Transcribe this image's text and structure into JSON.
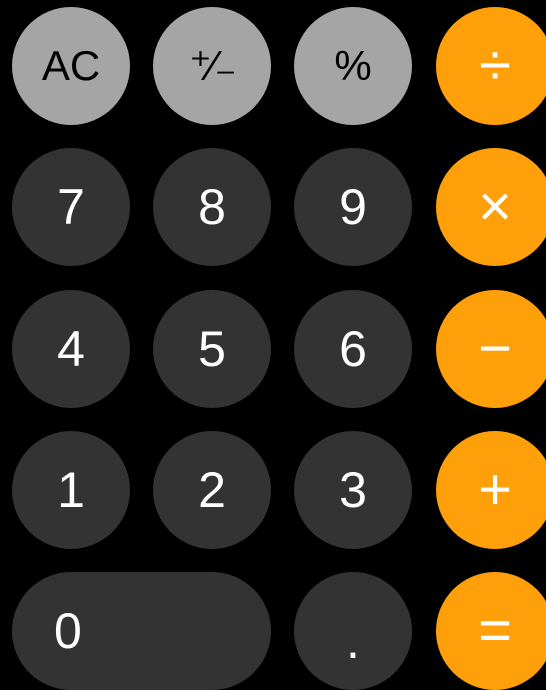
{
  "keypad": {
    "row1": {
      "ac": "AC",
      "plus_minus": "⁺∕₋",
      "percent": "%",
      "divide": "÷"
    },
    "row2": {
      "seven": "7",
      "eight": "8",
      "nine": "9",
      "multiply": "×"
    },
    "row3": {
      "four": "4",
      "five": "5",
      "six": "6",
      "minus": "−"
    },
    "row4": {
      "one": "1",
      "two": "2",
      "three": "3",
      "plus": "+"
    },
    "row5": {
      "zero": "0",
      "decimal": ".",
      "equals": "="
    }
  },
  "colors": {
    "function_key": "#a5a5a5",
    "number_key": "#333333",
    "operator_key": "#ff9f0a",
    "background": "#000000"
  }
}
